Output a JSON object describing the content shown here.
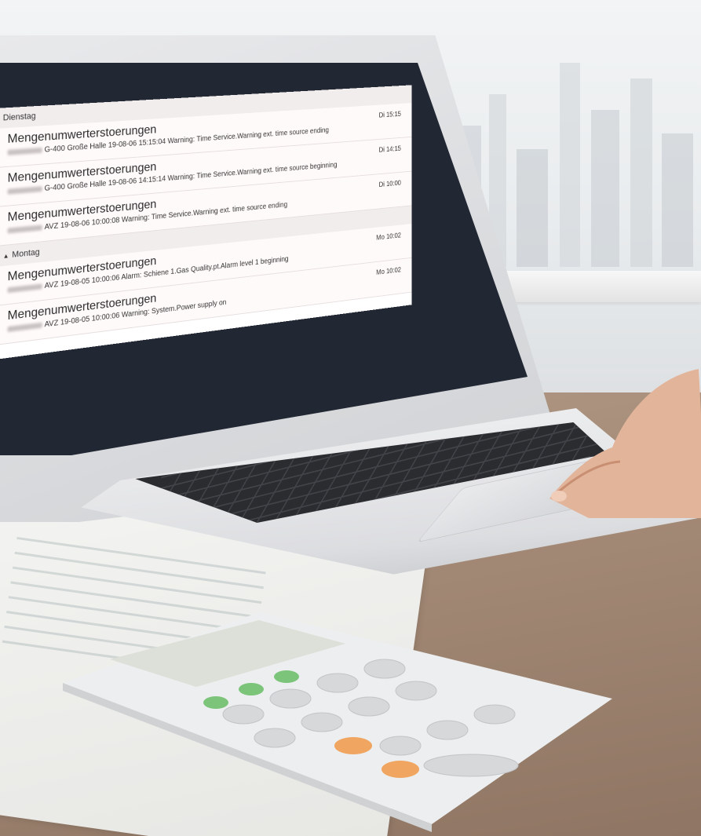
{
  "notifications": {
    "groups": [
      {
        "label": "Dienstag",
        "items": [
          {
            "title": "Mengenumwerterstoerungen",
            "detail": "G-400 Große Halle 19-08-06 15:15:04 Warning: Time Service.Warning ext. time source ending",
            "time": "Di 15:15"
          },
          {
            "title": "Mengenumwerterstoerungen",
            "detail": "G-400 Große Halle 19-08-06 14:15:14 Warning: Time Service.Warning ext. time source beginning",
            "time": "Di 14:15"
          },
          {
            "title": "Mengenumwerterstoerungen",
            "detail": "AVZ 19-08-06 10:00:08 Warning: Time Service.Warning ext. time source ending",
            "time": "Di 10:00"
          }
        ]
      },
      {
        "label": "Montag",
        "items": [
          {
            "title": "Mengenumwerterstoerungen",
            "detail": "AVZ 19-08-05 10:00:06 Alarm: Schiene 1.Gas Quality.pt.Alarm level 1 beginning",
            "time": "Mo 10:02"
          },
          {
            "title": "Mengenumwerterstoerungen",
            "detail": "AVZ 19-08-05 10:00:06 Warning: System.Power supply on",
            "time": "Mo 10:02"
          }
        ]
      }
    ],
    "collapse_icon": "triangle-down-icon"
  },
  "colors": {
    "screen_bezel": "#222734",
    "list_background": "#ffffff",
    "group_header_background": "#f1eded"
  }
}
